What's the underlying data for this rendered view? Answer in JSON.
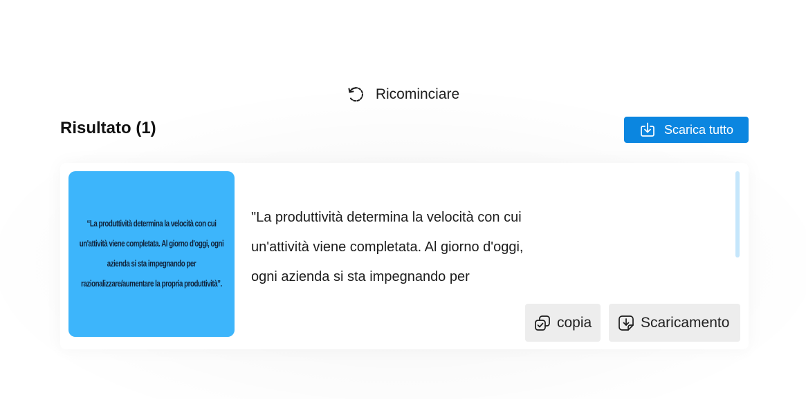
{
  "restart": {
    "label": "Ricominciare",
    "icon": "restart-icon"
  },
  "results": {
    "title": "Risultato (1)",
    "download_all_label": "Scarica tutto",
    "download_all_icon": "download-icon",
    "download_all_color": "#0b86e0"
  },
  "card": {
    "image_text": "“La produttività determina la velocità con cui un'attività viene completata. Al giorno d'oggi, ogni azienda si sta impegnando per razionalizzare/aumentare la propria produttività”.",
    "image_background": "#3db5fb",
    "extracted_text": "\"La produttività determina la velocità con cui un'attività viene completata. Al giorno d'oggi, ogni azienda si sta impegnando per",
    "copy_label": "copia",
    "copy_icon": "copy-icon",
    "download_label": "Scaricamento",
    "download_icon": "file-download-icon"
  }
}
